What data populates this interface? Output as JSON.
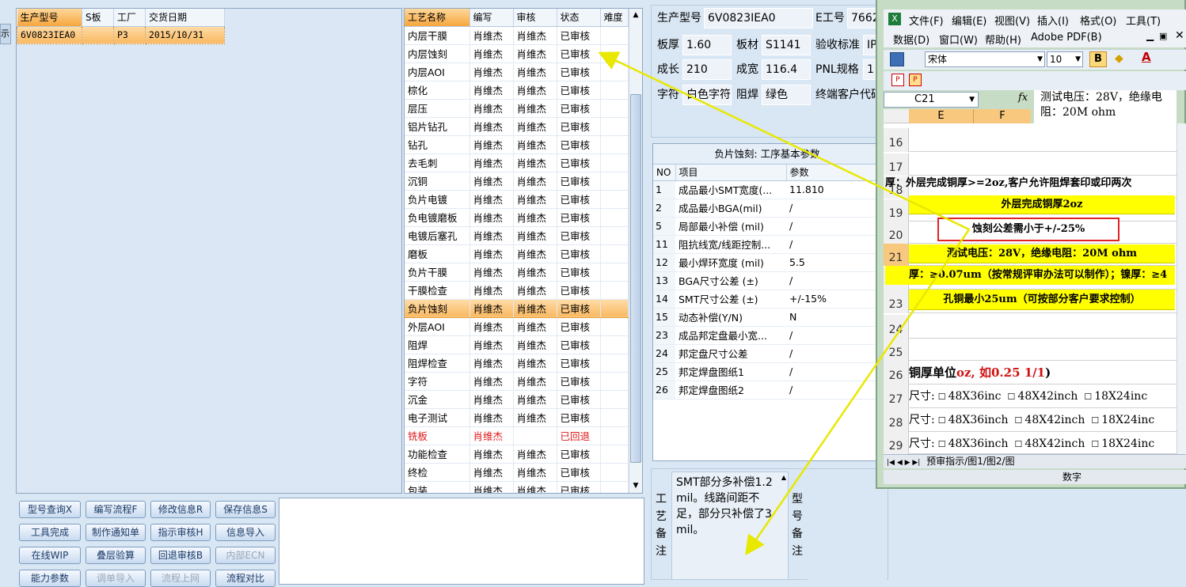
{
  "order_grid": {
    "headers": [
      "生产型号",
      "S板",
      "工厂",
      "交货日期"
    ],
    "rows": [
      [
        "6V0823IEA0",
        "",
        "P3",
        "2015/10/31"
      ]
    ]
  },
  "process_grid": {
    "headers": [
      "工艺名称",
      "编写",
      "审核",
      "状态",
      "难度"
    ],
    "rows": [
      [
        "内层干膜",
        "肖维杰",
        "肖维杰",
        "已审核"
      ],
      [
        "内层蚀刻",
        "肖维杰",
        "肖维杰",
        "已审核"
      ],
      [
        "内层AOI",
        "肖维杰",
        "肖维杰",
        "已审核"
      ],
      [
        "棕化",
        "肖维杰",
        "肖维杰",
        "已审核"
      ],
      [
        "层压",
        "肖维杰",
        "肖维杰",
        "已审核"
      ],
      [
        "铝片钻孔",
        "肖维杰",
        "肖维杰",
        "已审核"
      ],
      [
        "钻孔",
        "肖维杰",
        "肖维杰",
        "已审核"
      ],
      [
        "去毛刺",
        "肖维杰",
        "肖维杰",
        "已审核"
      ],
      [
        "沉铜",
        "肖维杰",
        "肖维杰",
        "已审核"
      ],
      [
        "负片电镀",
        "肖维杰",
        "肖维杰",
        "已审核"
      ],
      [
        "负电镀磨板",
        "肖维杰",
        "肖维杰",
        "已审核"
      ],
      [
        "电镀后塞孔",
        "肖维杰",
        "肖维杰",
        "已审核"
      ],
      [
        "磨板",
        "肖维杰",
        "肖维杰",
        "已审核"
      ],
      [
        "负片干膜",
        "肖维杰",
        "肖维杰",
        "已审核"
      ],
      [
        "干膜检查",
        "肖维杰",
        "肖维杰",
        "已审核"
      ],
      [
        "负片蚀刻",
        "肖维杰",
        "肖维杰",
        "已审核"
      ],
      [
        "外层AOI",
        "肖维杰",
        "肖维杰",
        "已审核"
      ],
      [
        "阻焊",
        "肖维杰",
        "肖维杰",
        "已审核"
      ],
      [
        "阻焊检查",
        "肖维杰",
        "肖维杰",
        "已审核"
      ],
      [
        "字符",
        "肖维杰",
        "肖维杰",
        "已审核"
      ],
      [
        "沉金",
        "肖维杰",
        "肖维杰",
        "已审核"
      ],
      [
        "电子测试",
        "肖维杰",
        "肖维杰",
        "已审核"
      ],
      [
        "铣板",
        "肖维杰",
        "",
        "已回退"
      ],
      [
        "功能检查",
        "肖维杰",
        "肖维杰",
        "已审核"
      ],
      [
        "终检",
        "肖维杰",
        "肖维杰",
        "已审核"
      ],
      [
        "包装",
        "肖维杰",
        "肖维杰",
        "已审核"
      ]
    ],
    "selected_index": 15,
    "returned_index": 22
  },
  "buttons": [
    [
      "型号查询X",
      "编写流程F",
      "修改信息R",
      "保存信息S"
    ],
    [
      "工具完成",
      "制作通知单",
      "指示审核H",
      "信息导入"
    ],
    [
      "在线WIP",
      "叠层验算",
      "回退审核B",
      "内部ECN"
    ],
    [
      "能力参数",
      "调单导入",
      "流程上网",
      "流程对比"
    ]
  ],
  "info": {
    "model_label": "生产型号",
    "model_value": "6V0823IEA0",
    "e_label": "E工号",
    "e_value": "7662",
    "thick_label": "板厚",
    "thick_value": "1.60",
    "mat_label": "板材",
    "mat_value": "S1141",
    "accept_label": "验收标准",
    "accept_value": "IP",
    "len_label": "成长",
    "len_value": "210",
    "wid_label": "成宽",
    "wid_value": "116.4",
    "pnl_label": "PNL规格",
    "pnl_value": "1",
    "char_label": "字符",
    "char_value": "白色字符",
    "mask_label": "阻焊",
    "mask_value": "绿色",
    "cust_label": "终端客户代码"
  },
  "params": {
    "title": "负片蚀刻: 工序基本参数",
    "headers": [
      "NO",
      "项目",
      "参数"
    ],
    "rows": [
      [
        "1",
        "成品最小SMT宽度(...",
        "11.810"
      ],
      [
        "2",
        "成品最小BGA(mil)",
        "/"
      ],
      [
        "5",
        "局部最小补偿 (mil)",
        "/"
      ],
      [
        "11",
        "阻抗线宽/线距控制...",
        "/"
      ],
      [
        "12",
        "最小焊环宽度 (mil)",
        "5.5"
      ],
      [
        "13",
        "BGA尺寸公差 (±)",
        "/"
      ],
      [
        "14",
        "SMT尺寸公差 (±)",
        "+/-15%"
      ],
      [
        "15",
        "动态补偿(Y/N)",
        "N"
      ],
      [
        "23",
        "成品邦定盘最小宽...",
        "/"
      ],
      [
        "24",
        "邦定盘尺寸公差",
        "/"
      ],
      [
        "25",
        "邦定焊盘图纸1",
        "/"
      ],
      [
        "26",
        "邦定焊盘图纸2",
        "/"
      ]
    ]
  },
  "notes": {
    "process_label": "工艺备注",
    "process_text": "SMT部分多补偿1.2mil。线路间距不足，部分只补偿了3mil。",
    "model_label": "型号备注"
  },
  "excel": {
    "menu1": [
      "文件(F)",
      "编辑(E)",
      "视图(V)",
      "插入(I)",
      "格式(O)",
      "工具(T)"
    ],
    "menu2": [
      "数据(D)",
      "窗口(W)",
      "帮助(H)",
      "Adobe PDF(B)"
    ],
    "font_name": "宋体",
    "font_size": "10",
    "bold": "B",
    "fx": "fx",
    "cell_ref": "C21",
    "formula": "测试电压：28V，绝缘电阻：20M ohm",
    "col_headers": [
      "E",
      "F"
    ],
    "row_numbers": [
      "16",
      "17",
      "18",
      "19",
      "20",
      "21",
      "22",
      "23",
      "24",
      "25",
      "26",
      "27",
      "28",
      "29"
    ],
    "row18": "厚：外层完成铜厚>=2oz,客户允许阻焊套印或印两次",
    "row19": "外层完成铜厚2oz",
    "row20": "蚀刻公差需小于+/-25%",
    "row21": "测试电压：28V，绝缘电阻：20M ohm",
    "row22": "厚：≥0.07um（按常规评审办法可以制作）；镍厚：≥4",
    "row23": "孔铜最小25um（可按部分客户要求控制）",
    "row26_a": "铜厚单位",
    "row26_b": "oz, 如0.25 1/1",
    "row26_c": ")",
    "size_label": "尺寸:",
    "row27": [
      "48X36inc",
      "48X42inch",
      "18X24inc"
    ],
    "row28": [
      "48X36inch",
      "48X42inch",
      "18X24inc"
    ],
    "row29": [
      "48X36inch",
      "48X42inch",
      "18X24inc"
    ],
    "sheet_tabs": "预审指示/图1/图2/图",
    "status": "数字"
  }
}
